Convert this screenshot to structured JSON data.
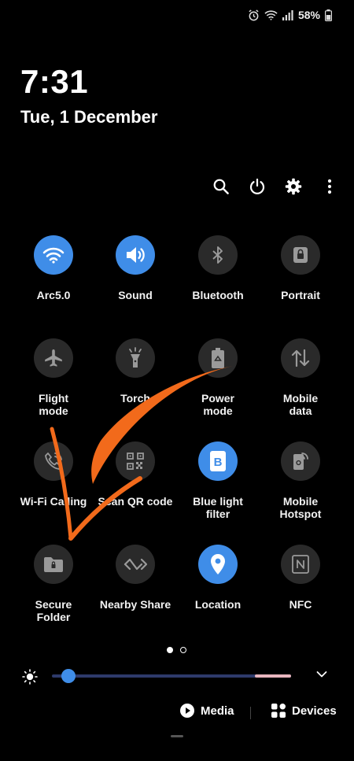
{
  "status_bar": {
    "battery_text": "58%",
    "icons": [
      "alarm-icon",
      "wifi-icon",
      "signal-icon",
      "battery-icon"
    ]
  },
  "clock": {
    "time": "7:31",
    "date": "Tue, 1 December"
  },
  "actions": [
    "search-icon",
    "power-icon",
    "gear-icon",
    "more-icon"
  ],
  "tiles": [
    {
      "label": "Arc5.0",
      "icon": "wifi-icon",
      "on": true
    },
    {
      "label": "Sound",
      "icon": "speaker-icon",
      "on": true
    },
    {
      "label": "Bluetooth",
      "icon": "bluetooth-icon",
      "on": false
    },
    {
      "label": "Portrait",
      "icon": "rotation-lock-icon",
      "on": false
    },
    {
      "label": "Flight\nmode",
      "icon": "airplane-icon",
      "on": false
    },
    {
      "label": "Torch",
      "icon": "torch-icon",
      "on": false
    },
    {
      "label": "Power\nmode",
      "icon": "battery-recycle-icon",
      "on": false
    },
    {
      "label": "Mobile\ndata",
      "icon": "data-arrows-icon",
      "on": false
    },
    {
      "label": "Wi-Fi Calling",
      "icon": "wifi-call-icon",
      "on": false
    },
    {
      "label": "Scan QR code",
      "icon": "qr-code-icon",
      "on": false
    },
    {
      "label": "Blue light\nfilter",
      "icon": "blue-light-icon",
      "on": true
    },
    {
      "label": "Mobile\nHotspot",
      "icon": "hotspot-icon",
      "on": false
    },
    {
      "label": "Secure\nFolder",
      "icon": "secure-folder-icon",
      "on": false
    },
    {
      "label": "Nearby Share",
      "icon": "nearby-share-icon",
      "on": false
    },
    {
      "label": "Location",
      "icon": "location-pin-icon",
      "on": true
    },
    {
      "label": "NFC",
      "icon": "nfc-icon",
      "on": false
    }
  ],
  "pager": {
    "pages": 2,
    "current": 1
  },
  "brightness": {
    "level": 0.07
  },
  "bottom": {
    "media_label": "Media",
    "devices_label": "Devices"
  },
  "colors": {
    "accent": "#3f8de8",
    "tile_off": "#2a2a2a",
    "annotation": "#f26a1b"
  }
}
